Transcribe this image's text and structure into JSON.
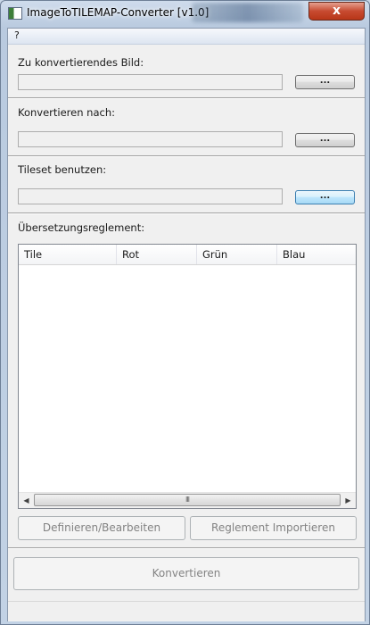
{
  "window": {
    "title": "ImageToTILEMAP-Converter [v1.0]",
    "close_glyph": "x"
  },
  "menubar": {
    "items": [
      "?"
    ]
  },
  "sections": {
    "input_image": {
      "label": "Zu konvertierendes Bild:",
      "value": "",
      "browse_label": "..."
    },
    "convert_to": {
      "label": "Konvertieren nach:",
      "value": "",
      "browse_label": "..."
    },
    "tileset": {
      "label": "Tileset benutzen:",
      "value": "",
      "browse_label": "..."
    },
    "rules": {
      "label": "Übersetzungsreglement:"
    }
  },
  "table": {
    "columns": [
      "Tile",
      "Rot",
      "Grün",
      "Blau"
    ],
    "rows": [],
    "scroll_left": "◀",
    "scroll_right": "▶",
    "scroll_grip": "III"
  },
  "buttons": {
    "define_edit": "Definieren/Bearbeiten",
    "import_rules": "Reglement Importieren",
    "convert": "Konvertieren"
  },
  "colors": {
    "accent_hover": "#bee6fd",
    "close": "#c74a30",
    "disabled_text": "#838383"
  }
}
